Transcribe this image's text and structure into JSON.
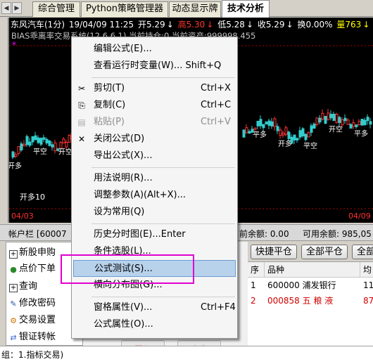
{
  "tabs": [
    {
      "label": "综合管理"
    },
    {
      "label": "Python策略管理器"
    },
    {
      "label": "动态显示牌"
    },
    {
      "label": "技术分析"
    }
  ],
  "chart_header": {
    "symbol": "东风汽车(1分)",
    "datetime": "19/04/09 11:25",
    "open": "开5.29",
    "open_dir": "↓",
    "high": "高5.30",
    "high_dir": "↓",
    "low": "低5.28",
    "low_dir": "↓",
    "close": "收5.29",
    "close_dir": "↓",
    "turnover": "换0.00%",
    "volume": "量763",
    "volume_dir": "↓",
    "indicator_line": "BIAS乖离率交易系统(12,6,6,1) 当前持仓:0 当前资产:999998.455"
  },
  "chart_dates": [
    "04/03",
    "04/09"
  ],
  "signal_labels": [
    "开多",
    "平空",
    "开空",
    "平多"
  ],
  "left_signal": "开多10",
  "account_bar": {
    "label": "帐户栏 [60007",
    "balance": "前余额: 0.00",
    "available": "可用余额: 985,05"
  },
  "left_panel": [
    {
      "icon": "plus-box-icon",
      "label": "新股申购"
    },
    {
      "icon": "coin-icon",
      "label": "点价下单"
    },
    {
      "icon": "plus-box-icon",
      "label": "查询"
    },
    {
      "icon": "edit-icon",
      "label": "修改密码"
    },
    {
      "icon": "settings-icon",
      "label": "交易设置"
    },
    {
      "icon": "transfer-icon",
      "label": "银证转帐"
    }
  ],
  "action_buttons": [
    "快捷平仓",
    "全部平仓",
    "全部"
  ],
  "bottom_buttons": [
    "买入",
    "卖出"
  ],
  "table": {
    "headers": [
      "序",
      "品种",
      "均"
    ],
    "rows": [
      {
        "seq": "1",
        "name": "600000 浦发银行",
        "avg": "11"
      },
      {
        "seq": "2",
        "name": "000858 五 粮 液",
        "avg": "87"
      }
    ]
  },
  "status_text": "组：1.指标交易)",
  "context_menu": [
    {
      "label": "编辑公式(E)...",
      "shortcut": "",
      "icon": "",
      "disabled": false
    },
    {
      "label": "查看运行时变量(W)... Shift+Q",
      "shortcut": "",
      "icon": "",
      "disabled": false
    },
    {
      "label": "剪切(T)",
      "shortcut": "Ctrl+X",
      "icon": "scissors-icon",
      "disabled": false
    },
    {
      "label": "复制(C)",
      "shortcut": "Ctrl+C",
      "icon": "copy-icon",
      "disabled": false
    },
    {
      "label": "粘贴(P)",
      "shortcut": "Ctrl+V",
      "icon": "paste-icon",
      "disabled": true
    },
    {
      "label": "关闭公式(D)",
      "shortcut": "",
      "icon": "close-icon",
      "disabled": false
    },
    {
      "label": "导出公式(X)...",
      "shortcut": "",
      "icon": "",
      "disabled": false
    },
    {
      "label": "用法说明(R)...",
      "shortcut": "",
      "icon": "",
      "disabled": false
    },
    {
      "label": "调整参数(A)(Alt+X)...",
      "shortcut": "",
      "icon": "",
      "disabled": false
    },
    {
      "label": "设为常用(Q)",
      "shortcut": "",
      "icon": "",
      "disabled": false
    },
    {
      "label": "历史分时图(E)...Enter",
      "shortcut": "",
      "icon": "",
      "disabled": false
    },
    {
      "label": "条件选股(L)...",
      "shortcut": "",
      "icon": "",
      "disabled": false
    },
    {
      "label": "公式测试(S)...",
      "shortcut": "",
      "icon": "",
      "disabled": false,
      "highlighted": true
    },
    {
      "label": "横向分布图(G)...",
      "shortcut": "",
      "icon": "",
      "disabled": false
    },
    {
      "label": "窗格属性(V)...",
      "shortcut": "Ctrl+F4",
      "icon": "",
      "disabled": false
    },
    {
      "label": "公式属性(O)...",
      "shortcut": "",
      "icon": "",
      "disabled": false
    }
  ],
  "colors": {
    "up": "#ff3333",
    "down": "#33cccc",
    "text_white": "#ffffff",
    "highlight_border": "#e000d0",
    "menu_highlight": "#b8d2ec"
  }
}
